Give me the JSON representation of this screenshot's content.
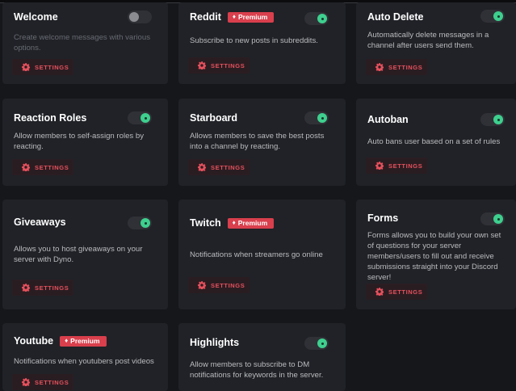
{
  "premium_label": "Premium",
  "settings_label": "SETTINGS",
  "colors": {
    "page_bg": "#16171b",
    "card_bg": "#202227",
    "toggle_on": "#3ecf8e",
    "premium_badge": "#d93f4c",
    "settings_text": "#e5505c"
  },
  "modules": [
    {
      "title": "Welcome",
      "premium": false,
      "enabled": false,
      "description": "Create welcome messages with various options."
    },
    {
      "title": "Reddit",
      "premium": true,
      "enabled": true,
      "description": "Subscribe to new posts in subreddits."
    },
    {
      "title": "Auto Delete",
      "premium": false,
      "enabled": true,
      "description": "Automatically delete messages in a channel after users send them."
    },
    {
      "title": "Reaction Roles",
      "premium": false,
      "enabled": true,
      "description": "Allow members to self-assign roles by reacting."
    },
    {
      "title": "Starboard",
      "premium": false,
      "enabled": true,
      "description": "Allows members to save the best posts into a channel by reacting."
    },
    {
      "title": "Autoban",
      "premium": false,
      "enabled": true,
      "description": "Auto bans user based on a set of rules"
    },
    {
      "title": "Giveaways",
      "premium": false,
      "enabled": true,
      "description": "Allows you to host giveaways on your server with Dyno."
    },
    {
      "title": "Twitch",
      "premium": true,
      "enabled": false,
      "description": "Notifications when streamers go online"
    },
    {
      "title": "Forms",
      "premium": false,
      "enabled": true,
      "description": "Forms allows you to build your own set of questions for your server members/users to fill out and receive submissions straight into your Discord server!"
    },
    {
      "title": "Youtube",
      "premium": true,
      "enabled": false,
      "description": "Notifications when youtubers post videos"
    },
    {
      "title": "Highlights",
      "premium": false,
      "enabled": true,
      "description": "Allow members to subscribe to DM notifications for keywords in the server."
    }
  ]
}
